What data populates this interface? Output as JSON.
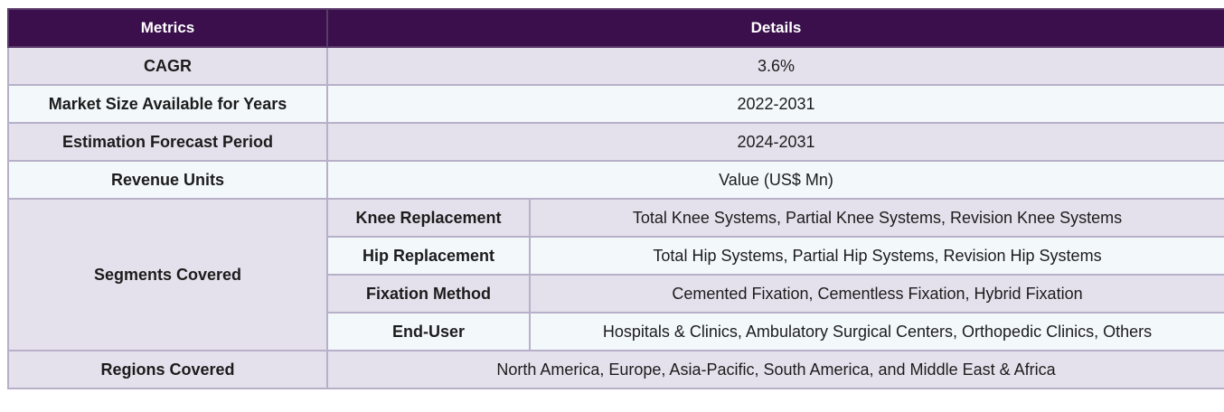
{
  "header": {
    "metrics": "Metrics",
    "details": "Details"
  },
  "rows": {
    "cagr": {
      "label": "CAGR",
      "value": "3.6%"
    },
    "market_size": {
      "label": "Market Size Available for Years",
      "value": "2022-2031"
    },
    "forecast": {
      "label": "Estimation Forecast Period",
      "value": "2024-2031"
    },
    "revenue": {
      "label": "Revenue Units",
      "value": "Value (US$ Mn)"
    },
    "segments": {
      "label": "Segments Covered",
      "items": [
        {
          "name": "Knee Replacement",
          "value": "Total Knee Systems, Partial Knee Systems, Revision Knee Systems"
        },
        {
          "name": "Hip Replacement",
          "value": "Total Hip Systems, Partial Hip Systems, Revision Hip Systems"
        },
        {
          "name": "Fixation Method",
          "value": "Cemented Fixation, Cementless Fixation, Hybrid Fixation"
        },
        {
          "name": "End-User",
          "value": "Hospitals & Clinics, Ambulatory Surgical Centers, Orthopedic Clinics, Others"
        }
      ]
    },
    "regions": {
      "label": "Regions Covered",
      "value": "North America, Europe, Asia-Pacific, South America, and Middle East & Africa"
    }
  }
}
